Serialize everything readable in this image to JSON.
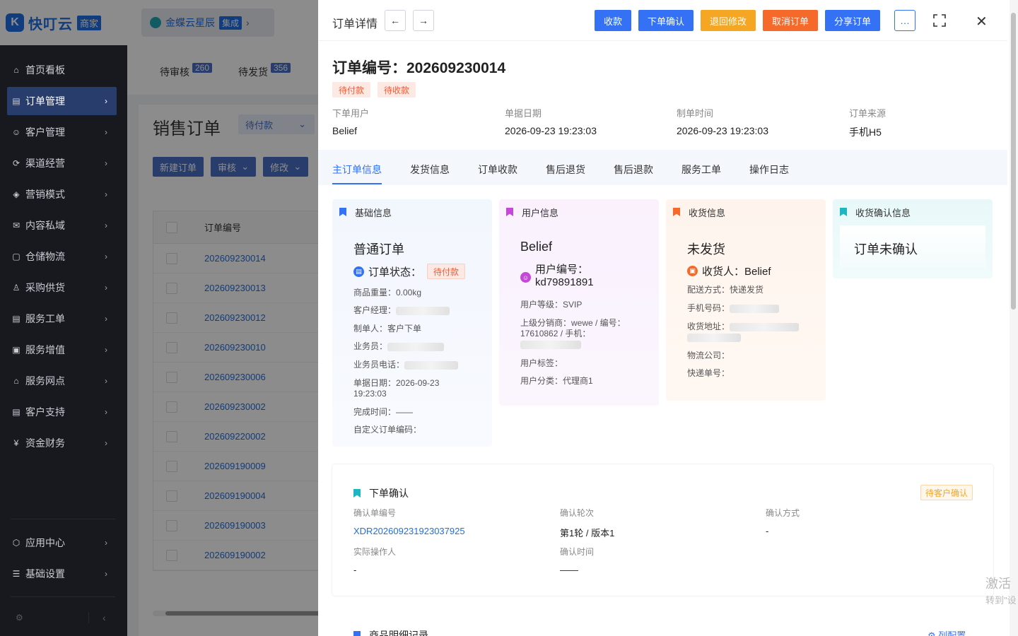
{
  "brand": {
    "logo_letter": "K",
    "name": "快叮云",
    "badge": "商家"
  },
  "kingdee": {
    "name": "金蝶云星辰",
    "badge": "集成",
    "arrow": "›"
  },
  "sidebar": {
    "items": [
      {
        "label": "首页看板",
        "icon": "⌂",
        "arrow": ""
      },
      {
        "label": "订单管理",
        "icon": "▤",
        "arrow": "›"
      },
      {
        "label": "客户管理",
        "icon": "☺",
        "arrow": "›"
      },
      {
        "label": "渠道经营",
        "icon": "⟳",
        "arrow": "›"
      },
      {
        "label": "营销模式",
        "icon": "◈",
        "arrow": "›"
      },
      {
        "label": "内容私域",
        "icon": "✉",
        "arrow": "›"
      },
      {
        "label": "仓储物流",
        "icon": "▢",
        "arrow": "›"
      },
      {
        "label": "采购供货",
        "icon": "♙",
        "arrow": "›"
      },
      {
        "label": "服务工单",
        "icon": "▤",
        "arrow": "›"
      },
      {
        "label": "服务增值",
        "icon": "▣",
        "arrow": "›"
      },
      {
        "label": "服务网点",
        "icon": "⌂",
        "arrow": "›"
      },
      {
        "label": "客户支持",
        "icon": "▤",
        "arrow": "›"
      },
      {
        "label": "资金财务",
        "icon": "¥",
        "arrow": "›"
      }
    ],
    "bottom_items": [
      {
        "label": "应用中心",
        "icon": "⬡",
        "arrow": "›"
      },
      {
        "label": "基础设置",
        "icon": "☰",
        "arrow": "›"
      }
    ],
    "footer_gear": "⚙",
    "footer_collapse": "‹"
  },
  "bg": {
    "tabs": [
      {
        "label": "待审核",
        "count": "260"
      },
      {
        "label": "待发货",
        "count": "356"
      }
    ],
    "title": "销售订单",
    "select_value": "待付款",
    "buttons": [
      "新建订单",
      "审核",
      "修改"
    ],
    "table_header": "订单编号",
    "rows": [
      "202609230014",
      "202609230013",
      "202609230012",
      "202609230010",
      "202609230006",
      "202609230002",
      "202609220002",
      "202609190009",
      "202609190004",
      "202609190003",
      "202609190002"
    ]
  },
  "drawer": {
    "title": "订单详情",
    "prev": "←",
    "next": "→",
    "actions": [
      {
        "label": "收款",
        "color": "#3471f4"
      },
      {
        "label": "下单确认",
        "color": "#3471f4"
      },
      {
        "label": "退回修改",
        "color": "#f5a623"
      },
      {
        "label": "取消订单",
        "color": "#f56a2a"
      },
      {
        "label": "分享订单",
        "color": "#3471f4"
      }
    ],
    "more": "…",
    "close": "✕",
    "order_no": "订单编号：202609230014",
    "tags": [
      "待付款",
      "待收款"
    ],
    "meta": [
      {
        "k": "下单用户",
        "v": "Belief"
      },
      {
        "k": "单据日期",
        "v": "2026-09-23 19:23:03"
      },
      {
        "k": "制单时间",
        "v": "2026-09-23 19:23:03"
      },
      {
        "k": "订单来源",
        "v": "手机H5"
      }
    ],
    "tabs": [
      "主订单信息",
      "发货信息",
      "订单收款",
      "售后退货",
      "售后退款",
      "服务工单",
      "操作日志"
    ],
    "cards": {
      "basic": {
        "head": "基础信息",
        "title": "普通订单",
        "status_label": "订单状态：",
        "status_tag": "待付款",
        "weight": "商品重量：0.00kg",
        "manager": "客户经理：",
        "maker": "制单人：客户下单",
        "sales": "业务员：",
        "sales_phone": "业务员电话：",
        "doc_date_1": "单据日期：2026-09-23",
        "doc_date_2": "19:23:03",
        "done_time": "完成时间：——",
        "custom_code": "自定义订单编码："
      },
      "user": {
        "head": "用户信息",
        "title": "Belief",
        "uid_1": "用户编号：",
        "uid_2": "kd79891891",
        "level": "用户等级：SVIP",
        "dist_1": "上级分销商：wewe / 编号：",
        "dist_2": "17610862 / 手机：",
        "label": "用户标签：",
        "category": "用户分类：代理商1"
      },
      "ship": {
        "head": "收货信息",
        "title": "未发货",
        "receiver": "收货人：Belief",
        "method": "配送方式：快递发货",
        "phone": "手机号码：",
        "address": "收货地址：",
        "logistics": "物流公司：",
        "tracking": "快递单号："
      },
      "confirm": {
        "head": "收货确认信息",
        "title": "订单未确认"
      }
    },
    "order_confirm": {
      "title": "下单确认",
      "badge": "待客户确认",
      "fields": [
        {
          "k": "确认单编号",
          "v": "XDR202609231923037925"
        },
        {
          "k": "确认轮次",
          "v": "第1轮 / 版本1"
        },
        {
          "k": "确认方式",
          "v": "-"
        },
        {
          "k": "实际操作人",
          "v": "-"
        },
        {
          "k": "确认时间",
          "v": "——"
        }
      ]
    },
    "goods": {
      "title": "商品明细记录",
      "link": "列配置"
    }
  },
  "watermark": {
    "line1": "激活",
    "line2": "转到\"设"
  },
  "colors": {
    "primary": "#3471f4",
    "sidebar_bg": "#2b2f3a",
    "warning": "#f5a623",
    "danger": "#f56a2a"
  }
}
